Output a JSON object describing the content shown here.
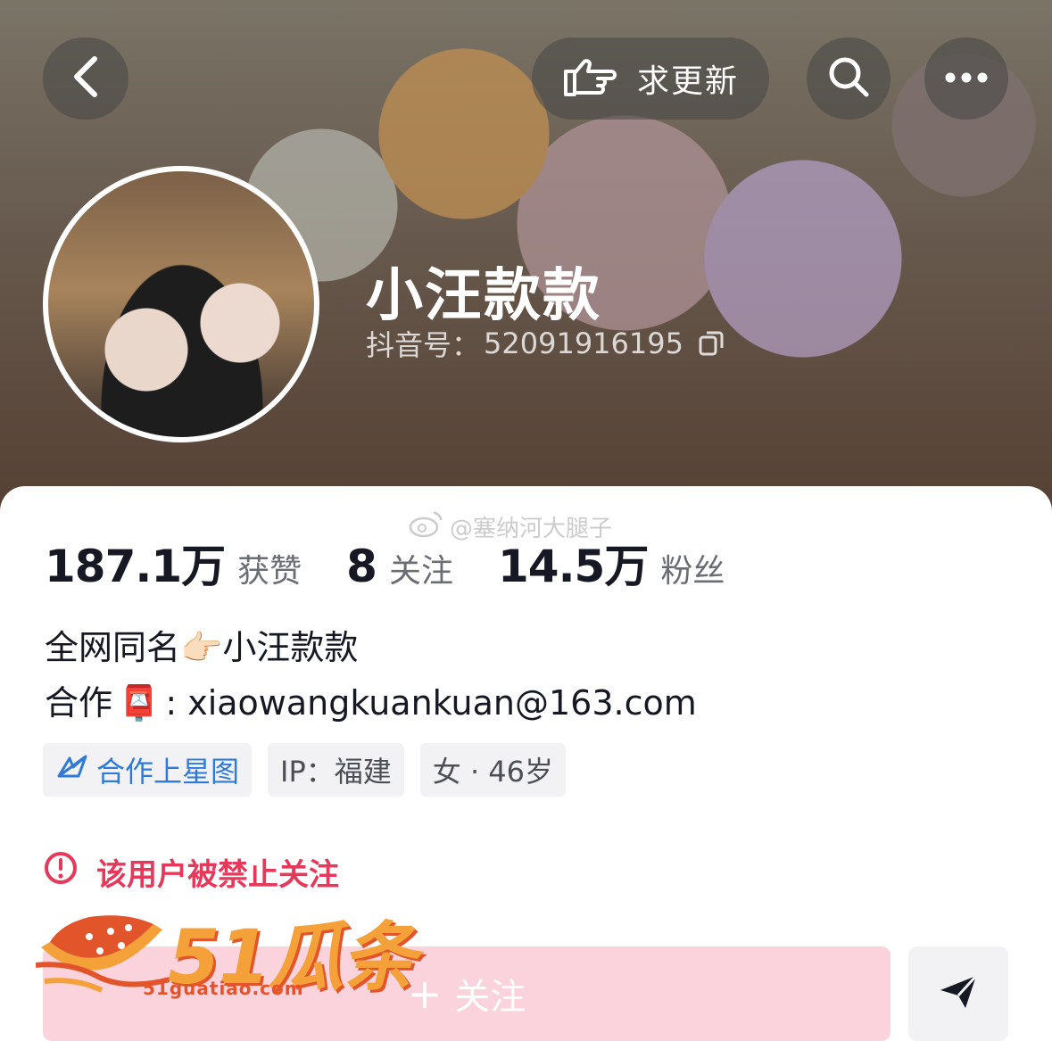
{
  "header": {
    "update_label": "求更新"
  },
  "profile": {
    "nickname": "小汪款款",
    "account_label": "抖音号：",
    "account_id": "52091916195"
  },
  "stats": [
    {
      "value": "187.1万",
      "label": "获赞"
    },
    {
      "value": "8",
      "label": "关注"
    },
    {
      "value": "14.5万",
      "label": "粉丝"
    }
  ],
  "watermark": {
    "text": "@塞纳河大腿子"
  },
  "bio": {
    "line1_text": "全网同名",
    "line1_emoji": "👉🏻",
    "line1_name": "小汪款款",
    "line2_label": "合作",
    "line2_emoji": "📮",
    "line2_email": ": xiaowangkuankuan@163.com"
  },
  "tags": {
    "star_map": "合作上星图",
    "ip": "IP：福建",
    "gender_age": "女 · 46岁"
  },
  "notice": {
    "banned_text": "该用户被禁止关注"
  },
  "actions": {
    "follow_plus": "+",
    "follow_label": "关注"
  },
  "logo": {
    "text": "51瓜条",
    "url": "51guatiao.com"
  },
  "colors": {
    "accent_pink": "#fbd3dc",
    "warning_red": "#e5385a",
    "star_blue": "#2f7ad8",
    "logo_orange": "#f5a13a"
  },
  "icons": [
    "back-arrow-icon",
    "pointing-hand-icon",
    "search-icon",
    "more-dots-icon",
    "copy-icon",
    "weibo-icon",
    "star-map-icon",
    "exclamation-circle-icon",
    "send-icon"
  ]
}
